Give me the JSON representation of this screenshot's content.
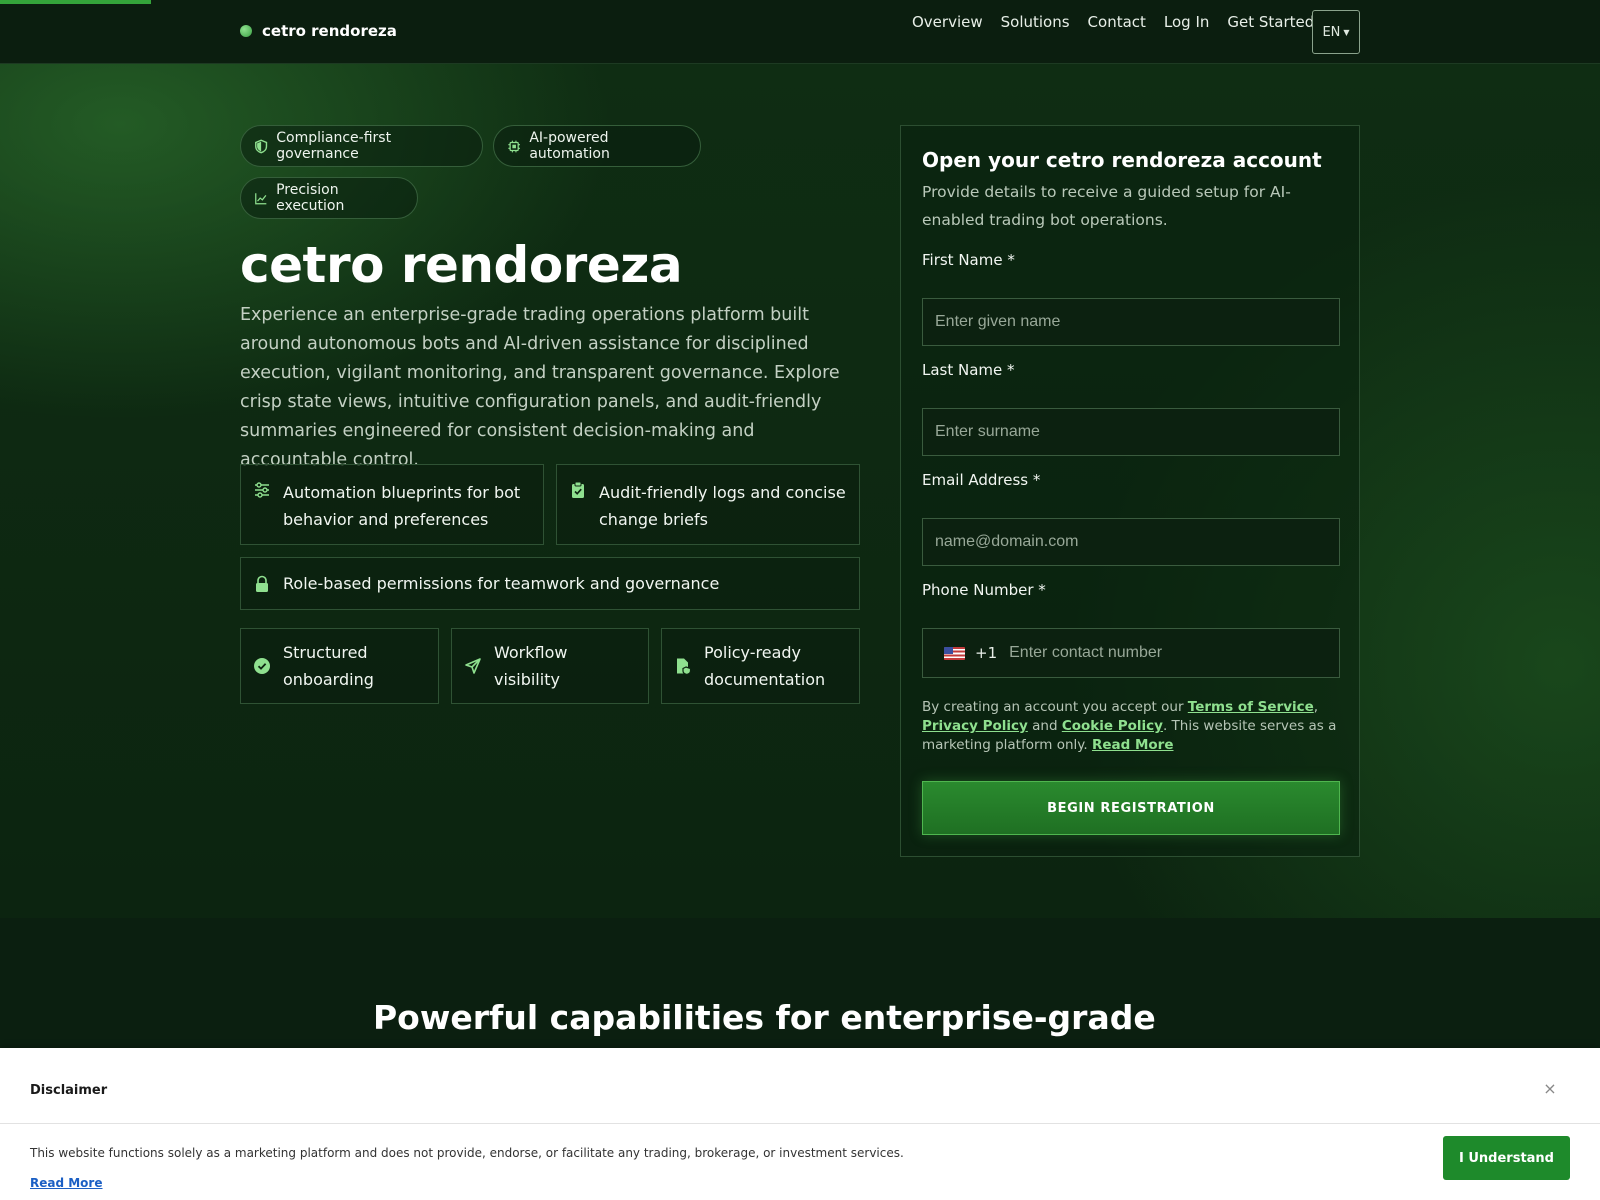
{
  "header": {
    "brand": "cetro rendoreza",
    "nav": [
      "Overview",
      "Solutions",
      "Contact",
      "Log In",
      "Get Started"
    ],
    "lang": "EN"
  },
  "hero": {
    "pills": [
      "Compliance-first governance",
      "AI-powered automation",
      "Precision execution"
    ],
    "title": "cetro rendoreza",
    "description": "Experience an enterprise-grade trading operations platform built around autonomous bots and AI-driven assistance for disciplined execution, vigilant monitoring, and transparent governance. Explore crisp state views, intuitive configuration panels, and audit-friendly summaries engineered for consistent decision-making and accountable control.",
    "features_wide": [
      {
        "text": "Automation blueprints for bot behavior and preferences",
        "icon": "sliders-icon"
      },
      {
        "text": "Audit-friendly logs and concise change briefs",
        "icon": "clipboard-check-icon"
      },
      {
        "text": "Role-based permissions for teamwork and governance",
        "icon": "lock-icon"
      }
    ],
    "features_small": [
      {
        "text": "Structured onboarding",
        "icon": "check-circle-icon"
      },
      {
        "text": "Workflow visibility",
        "icon": "send-icon"
      },
      {
        "text": "Policy-ready documentation",
        "icon": "file-shield-icon"
      }
    ]
  },
  "form": {
    "title": "Open your cetro rendoreza account",
    "subtitle": "Provide details to receive a guided setup for AI-enabled trading bot operations.",
    "first_name_label": "First Name *",
    "first_name_placeholder": "Enter given name",
    "last_name_label": "Last Name *",
    "last_name_placeholder": "Enter surname",
    "email_label": "Email Address *",
    "email_placeholder": "name@domain.com",
    "phone_label": "Phone Number *",
    "phone_dial": "+1",
    "phone_placeholder": "Enter contact number",
    "terms_prefix": "By creating an account you accept our ",
    "terms_link": "Terms of Service",
    "privacy_link": "Privacy Policy",
    "and": " and ",
    "cookie_link": "Cookie Policy",
    "terms_suffix": ". This website serves as a marketing platform only. ",
    "read_more": "Read More",
    "submit": "BEGIN REGISTRATION"
  },
  "section": {
    "title": "Powerful capabilities for enterprise-grade"
  },
  "disclaimer": {
    "title": "Disclaimer",
    "close": "×",
    "text": "This website functions solely as a marketing platform and does not provide, endorse, or facilitate any trading, brokerage, or investment services.",
    "read_more": "Read More",
    "button": "I Understand"
  },
  "colors": {
    "accent": "#8fe08f",
    "button": "#1e8a2b",
    "background": "#0b1f10"
  }
}
